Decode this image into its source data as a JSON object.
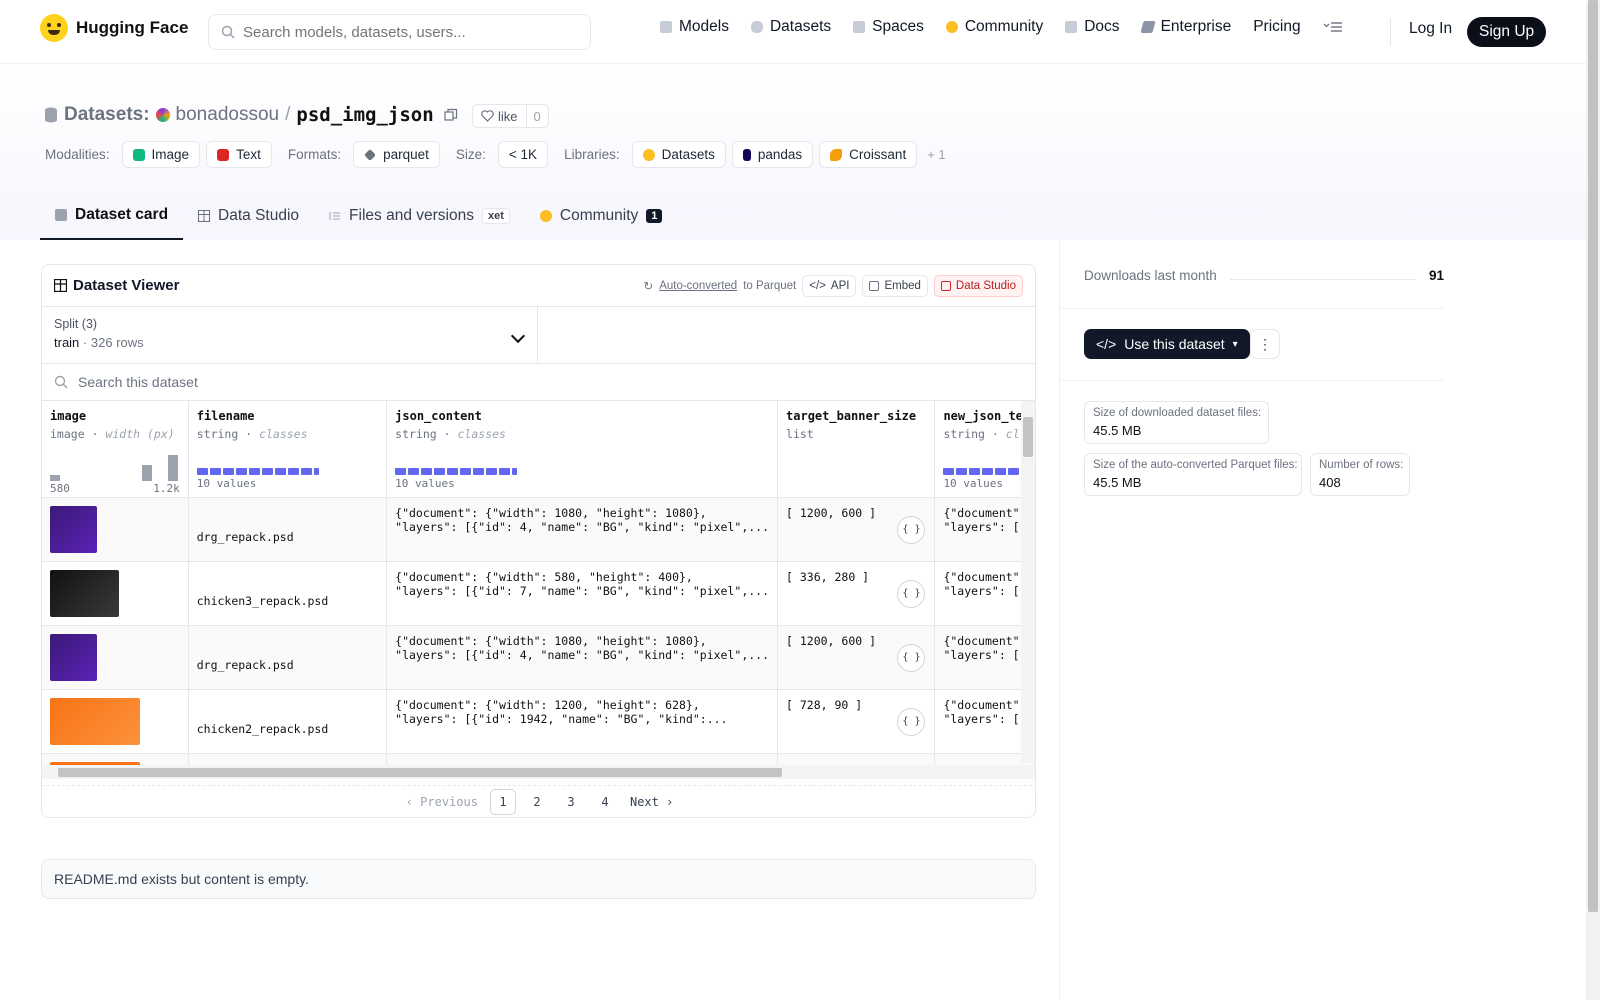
{
  "nav": {
    "brand": "Hugging Face",
    "search_placeholder": "Search models, datasets, users...",
    "links": [
      {
        "label": "Models"
      },
      {
        "label": "Datasets"
      },
      {
        "label": "Spaces"
      },
      {
        "label": "Community"
      },
      {
        "label": "Docs"
      },
      {
        "label": "Enterprise"
      },
      {
        "label": "Pricing"
      }
    ],
    "login": "Log In",
    "signup": "Sign Up"
  },
  "repo": {
    "type_label": "Datasets:",
    "owner": "bonadossou",
    "slash": "/",
    "name": "psd_img_json",
    "like_label": "like",
    "like_count": "0"
  },
  "tags": {
    "modalities_label": "Modalities:",
    "modalities": [
      "Image",
      "Text"
    ],
    "formats_label": "Formats:",
    "formats": [
      "parquet"
    ],
    "size_label": "Size:",
    "size": "< 1K",
    "libraries_label": "Libraries:",
    "libraries": [
      "Datasets",
      "pandas",
      "Croissant"
    ],
    "more": "+ 1"
  },
  "tabs": [
    {
      "label": "Dataset card"
    },
    {
      "label": "Data Studio"
    },
    {
      "label": "Files and versions",
      "badge": "xet"
    },
    {
      "label": "Community",
      "badge": "1"
    }
  ],
  "viewer": {
    "title": "Dataset Viewer",
    "auto_converted": "Auto-converted",
    "to_parquet": "to Parquet",
    "api": "API",
    "embed": "Embed",
    "data_studio": "Data Studio",
    "split_label": "Split (3)",
    "split_value": "train",
    "split_sep": "·",
    "split_rows": "326 rows",
    "search_placeholder": "Search this dataset",
    "columns": [
      {
        "name": "image",
        "type": "image",
        "hint": "width (px)",
        "min": "580",
        "max": "1.2k"
      },
      {
        "name": "filename",
        "type": "string",
        "hint": "classes",
        "count": "10 values"
      },
      {
        "name": "json_content",
        "type": "string",
        "hint": "classes",
        "count": "10 values"
      },
      {
        "name": "target_banner_size",
        "type": "list"
      },
      {
        "name": "new_json_te",
        "type": "string",
        "hint": "cl",
        "count": "10 values"
      }
    ],
    "type_sep": "·",
    "rows": [
      {
        "filename": "drg_repack.psd",
        "json1": "{\"document\": {\"width\": 1080, \"height\": 1080},",
        "json2": "\"layers\": [{\"id\": 4, \"name\": \"BG\", \"kind\": \"pixel\",...",
        "size": "[ 1200, 600 ]",
        "new1": "{\"document\"",
        "new2": "\"layers\": ["
      },
      {
        "filename": "chicken3_repack.psd",
        "json1": "{\"document\": {\"width\": 580, \"height\": 400},",
        "json2": "\"layers\": [{\"id\": 7, \"name\": \"BG\", \"kind\": \"pixel\",...",
        "size": "[ 336, 280 ]",
        "new1": "{\"document\"",
        "new2": "\"layers\": ["
      },
      {
        "filename": "drg_repack.psd",
        "json1": "{\"document\": {\"width\": 1080, \"height\": 1080},",
        "json2": "\"layers\": [{\"id\": 4, \"name\": \"BG\", \"kind\": \"pixel\",...",
        "size": "[ 1200, 600 ]",
        "new1": "{\"document\"",
        "new2": "\"layers\": ["
      },
      {
        "filename": "chicken2_repack.psd",
        "json1": "{\"document\": {\"width\": 1200, \"height\": 628},",
        "json2": "\"layers\": [{\"id\": 1942, \"name\": \"BG\", \"kind\":...",
        "size": "[ 728, 90 ]",
        "new1": "{\"document\"",
        "new2": "\"layers\": ["
      }
    ],
    "pager": {
      "prev": "Previous",
      "pages": [
        "1",
        "2",
        "3",
        "4"
      ],
      "next": "Next"
    }
  },
  "readme": "README.md exists but content is empty.",
  "sidebar": {
    "downloads_label": "Downloads last month",
    "downloads": "91",
    "use_label": "Use this dataset",
    "stats": [
      {
        "label": "Size of downloaded dataset files:",
        "value": "45.5 MB"
      },
      {
        "label": "Size of the auto-converted Parquet files:",
        "value": "45.5 MB"
      },
      {
        "label": "Number of rows:",
        "value": "408"
      }
    ]
  },
  "colors": {
    "accent": "#6366f1",
    "dark": "#111827"
  }
}
